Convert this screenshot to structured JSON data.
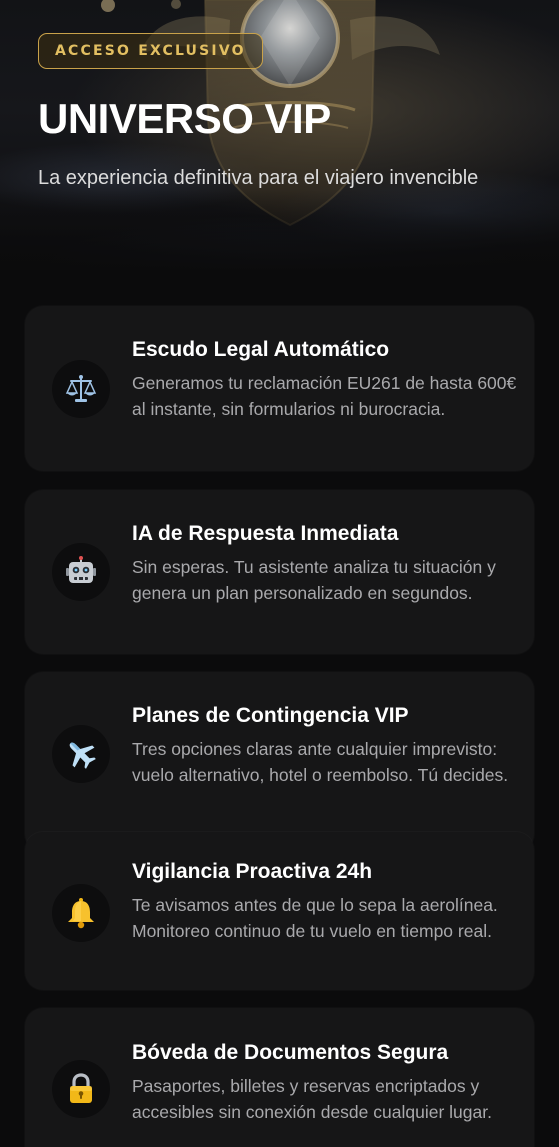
{
  "hero": {
    "badge": "ACCESO EXCLUSIVO",
    "title": "UNIVERSO VIP",
    "subtitle": "La experiencia definitiva para el viajero invencible"
  },
  "features": [
    {
      "icon": "scales-icon",
      "title": "Escudo Legal Automático",
      "description": "Generamos tu reclamación EU261 de hasta 600€ al instante, sin formularios ni burocracia."
    },
    {
      "icon": "robot-icon",
      "title": "IA de Respuesta Inmediata",
      "description": "Sin esperas. Tu asistente analiza tu situación y genera un plan personalizado en segundos."
    },
    {
      "icon": "airplane-icon",
      "title": "Planes de Contingencia VIP",
      "description": "Tres opciones claras ante cualquier imprevisto: vuelo alternativo, hotel o reembolso. Tú decides."
    },
    {
      "icon": "bell-icon",
      "title": "Vigilancia Proactiva 24h",
      "description": "Te avisamos antes de que lo sepa la aerolínea. Monitoreo continuo de tu vuelo en tiempo real."
    },
    {
      "icon": "lock-icon",
      "title": "Bóveda de Documentos Segura",
      "description": "Pasaportes, billetes y reservas encriptados y accesibles sin conexión desde cualquier lugar."
    }
  ],
  "colors": {
    "background": "#0b0b0c",
    "card": "#161617",
    "accent_gold": "#c9a24a",
    "title": "#ffffff",
    "description": "#a9a9ac"
  }
}
